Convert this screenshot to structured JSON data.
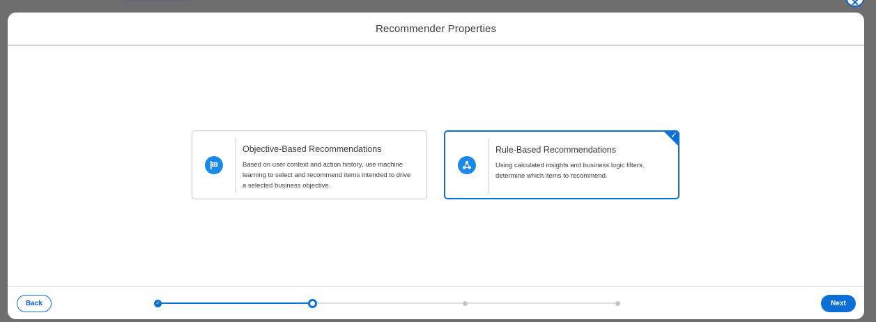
{
  "modal": {
    "title": "Recommender Properties",
    "close_icon": "close-icon"
  },
  "cards": [
    {
      "title": "Objective-Based Recommendations",
      "description": "Based on user context and action history, use machine learning to select and recommend items intended to drive a selected business objective.",
      "icon": "flag-icon",
      "selected": false
    },
    {
      "title": "Rule-Based Recommendations",
      "description": "Using calculated insights and business logic filters, determine which items to recommend.",
      "icon": "network-icon",
      "selected": true
    }
  ],
  "footer": {
    "back_label": "Back",
    "next_label": "Next"
  },
  "progress": {
    "total_steps": 4,
    "current_step": 2,
    "completed_steps": 1
  },
  "colors": {
    "accent": "#0b6fd6",
    "icon_bg": "#1b8ae6",
    "backdrop": "#6e6e6e",
    "text": "#3e3e3c"
  }
}
